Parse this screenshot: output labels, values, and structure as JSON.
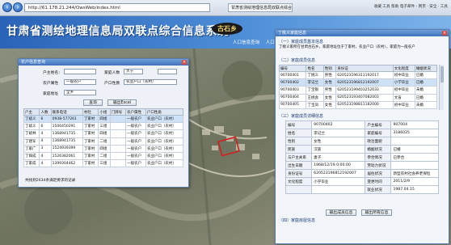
{
  "browser": {
    "address": "http://61.178.21.244/OwsWeb/index.html",
    "tab": "甘肃省测绘地理信息局双联点综合信息",
    "tools": "收藏  工具  帮助  电子邮件 - 网页 · 安全 · 工具"
  },
  "header": {
    "title": "甘肃省测绘地理信息局双联点综合信息系统",
    "logo": "古石乡",
    "nav": [
      "人口信息查询",
      "人口信息..."
    ]
  },
  "search_window": {
    "title": "农户信息查询",
    "labels": {
      "name": "户主姓名：",
      "count": "家庭人数",
      "attr": "农户属性",
      "hukou": "户口性质",
      "addr": "家庭地址"
    },
    "values": {
      "name": "",
      "count_op": "大于",
      "count": "",
      "attr": "一般农户",
      "hukou": "农业户口（农村）",
      "addr": "全乡"
    },
    "buttons": {
      "query": "查询",
      "export": "输出Excel"
    },
    "columns": [
      "户主",
      "人数",
      "联系电话",
      "村社",
      "小组",
      "门牌号",
      "农户属性",
      "户口性质"
    ],
    "rows": [
      [
        "丁斌义",
        "6",
        "0938-577261",
        "丁家村",
        "四组",
        "",
        "一般农户",
        "农业户口（农村）"
      ],
      [
        "丁斌义",
        "6",
        "1500450291",
        "丁家村",
        "三组",
        "",
        "一般农户",
        "农业户口（农村）"
      ],
      [
        "丁斌林",
        "4",
        "1368941735",
        "丁家村",
        "四组",
        "",
        "一般农户",
        "农业户口（农村）"
      ],
      [
        "丁建军",
        "4",
        "1368941735",
        "丁家村",
        "二组",
        "",
        "一般农户",
        "农业户口（农村）"
      ],
      [
        "丁家广",
        "3",
        "1524939399",
        "丁家村",
        "四组",
        "",
        "一般农户",
        "农业户口（农村）"
      ],
      [
        "丁辉成",
        "4",
        "1526382061",
        "丁家村",
        "二组",
        "",
        "一般农户",
        "农业户口（农村）"
      ],
      [
        "丁家成",
        "4",
        "1399304462",
        "丁家村",
        "三组",
        "",
        "一般农户",
        "农业户口（农村）"
      ]
    ],
    "footer": "共找到2634条满足要求的记录"
  },
  "detail_window": {
    "title": "丁桃义家庭信息",
    "section1": "（一）家庭成员基本信息",
    "intro": "丁桃义家所在甘肃古石乡，家庭地址位于丁家村，农业户口（农村），家庭为一般农户",
    "section2": "（二）家庭成员信息",
    "columns": [
      "编号",
      "姓名",
      "性别",
      "身份证",
      "文化程度",
      "婚姻状况"
    ],
    "rows": [
      [
        "90700401",
        "丁桃义",
        "男性",
        "620523196311192017",
        "初中毕业",
        "已婚"
      ],
      [
        "90700402",
        "李记兰",
        "女性",
        "620523196812192007",
        "小学毕业",
        "已婚"
      ],
      [
        "90700403",
        "丁宝银",
        "男性",
        "620523199403252033",
        "初中毕业",
        "未婚"
      ],
      [
        "90700404",
        "王桃会",
        "女性",
        "620523193407082003",
        "文盲",
        "已婚"
      ],
      [
        "90700405",
        "丁宝凤",
        "女性",
        "620523198811182000",
        "初中毕业",
        "未婚"
      ]
    ],
    "selected_row": 1,
    "section3": "（三）家庭成员详细信息",
    "details": [
      [
        "编号",
        "90700402",
        "户主编号",
        "907004"
      ],
      [
        "姓名",
        "李记兰",
        "家庭编号",
        "3186025"
      ],
      [
        "性别",
        "女性",
        "政治面貌",
        ""
      ],
      [
        "民族",
        "汉族",
        "婚姻状况",
        "已婚"
      ],
      [
        "与户主关系",
        "妻子",
        "参合情况",
        "已参合"
      ],
      [
        "出生日期",
        "1968/12/19 0:00:00",
        "劳动力状况",
        ""
      ],
      [
        "身份证号",
        "620523196812192007",
        "居住状况",
        "新型农村社会养老保险"
      ],
      [
        "文化程度",
        "小学毕业",
        "变更时间",
        "2011/2/9"
      ],
      [
        "",
        "",
        "就业状况",
        "1987.04.15"
      ]
    ],
    "buttons": {
      "export_info": "输出成员信息",
      "export_all": "输出所有信息"
    },
    "section4": "（四）家庭房屋信息"
  }
}
